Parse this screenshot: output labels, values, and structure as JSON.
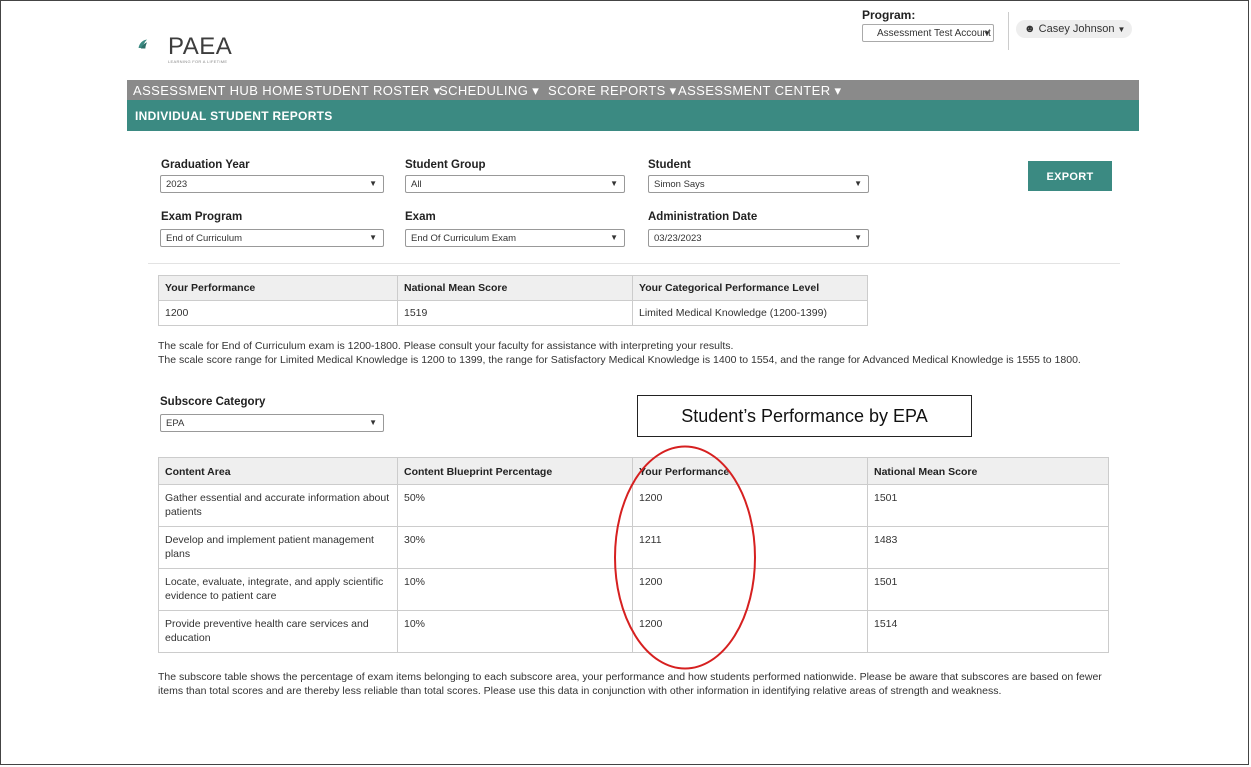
{
  "header": {
    "logo_text": "PAEA",
    "logo_tagline": "LEARNING FOR A LIFETIME",
    "program_label": "Program:",
    "program_value": "Assessment Test Account",
    "user_name": "Casey Johnson"
  },
  "nav": {
    "items": [
      {
        "label": "ASSESSMENT HUB HOME"
      },
      {
        "label": "STUDENT ROSTER ▾"
      },
      {
        "label": "SCHEDULING ▾"
      },
      {
        "label": "SCORE REPORTS ▾"
      },
      {
        "label": "ASSESSMENT CENTER ▾"
      }
    ],
    "subtitle": "INDIVIDUAL STUDENT REPORTS"
  },
  "filters": {
    "graduation_year": {
      "label": "Graduation Year",
      "value": "2023"
    },
    "student_group": {
      "label": "Student Group",
      "value": "All"
    },
    "student": {
      "label": "Student",
      "value": "Simon Says"
    },
    "exam_program": {
      "label": "Exam Program",
      "value": "End of Curriculum"
    },
    "exam": {
      "label": "Exam",
      "value": "End Of Curriculum Exam"
    },
    "admin_date": {
      "label": "Administration Date",
      "value": "03/23/2023"
    },
    "export_label": "EXPORT"
  },
  "summary": {
    "headers": [
      "Your Performance",
      "National Mean Score",
      "Your Categorical Performance Level"
    ],
    "row": [
      "1200",
      "1519",
      "Limited Medical Knowledge (1200-1399)"
    ]
  },
  "scale_note": {
    "line1": "The scale for End of Curriculum exam is 1200-1800. Please consult your faculty for assistance with interpreting your results.",
    "line2": "The scale score range for Limited Medical Knowledge is 1200 to 1399, the range for Satisfactory Medical Knowledge is 1400 to 1554, and the range for Advanced Medical Knowledge is 1555 to 1800."
  },
  "subscore": {
    "label": "Subscore Category",
    "value": "EPA"
  },
  "callout": "Student’s Performance by EPA",
  "subscore_table": {
    "headers": [
      "Content Area",
      "Content Blueprint Percentage",
      "Your Performance",
      "National Mean Score"
    ],
    "rows": [
      [
        "Gather essential and accurate information about patients",
        "50%",
        "1200",
        "1501"
      ],
      [
        "Develop and implement patient management plans",
        "30%",
        "1211",
        "1483"
      ],
      [
        "Locate, evaluate, integrate, and apply scientific evidence to patient care",
        "10%",
        "1200",
        "1501"
      ],
      [
        "Provide preventive health care services and education",
        "10%",
        "1200",
        "1514"
      ]
    ]
  },
  "footer_note": "The subscore table shows the percentage of exam items belonging to each subscore area, your performance and how students performed nationwide. Please be aware that subscores are based on fewer items than total scores and are thereby less reliable than total scores. Please use this data in conjunction with other information in identifying relative areas of strength and weakness.",
  "colors": {
    "teal": "#3b8a82",
    "nav_gray": "#8a8a8a",
    "annotation_red": "#d62020"
  }
}
